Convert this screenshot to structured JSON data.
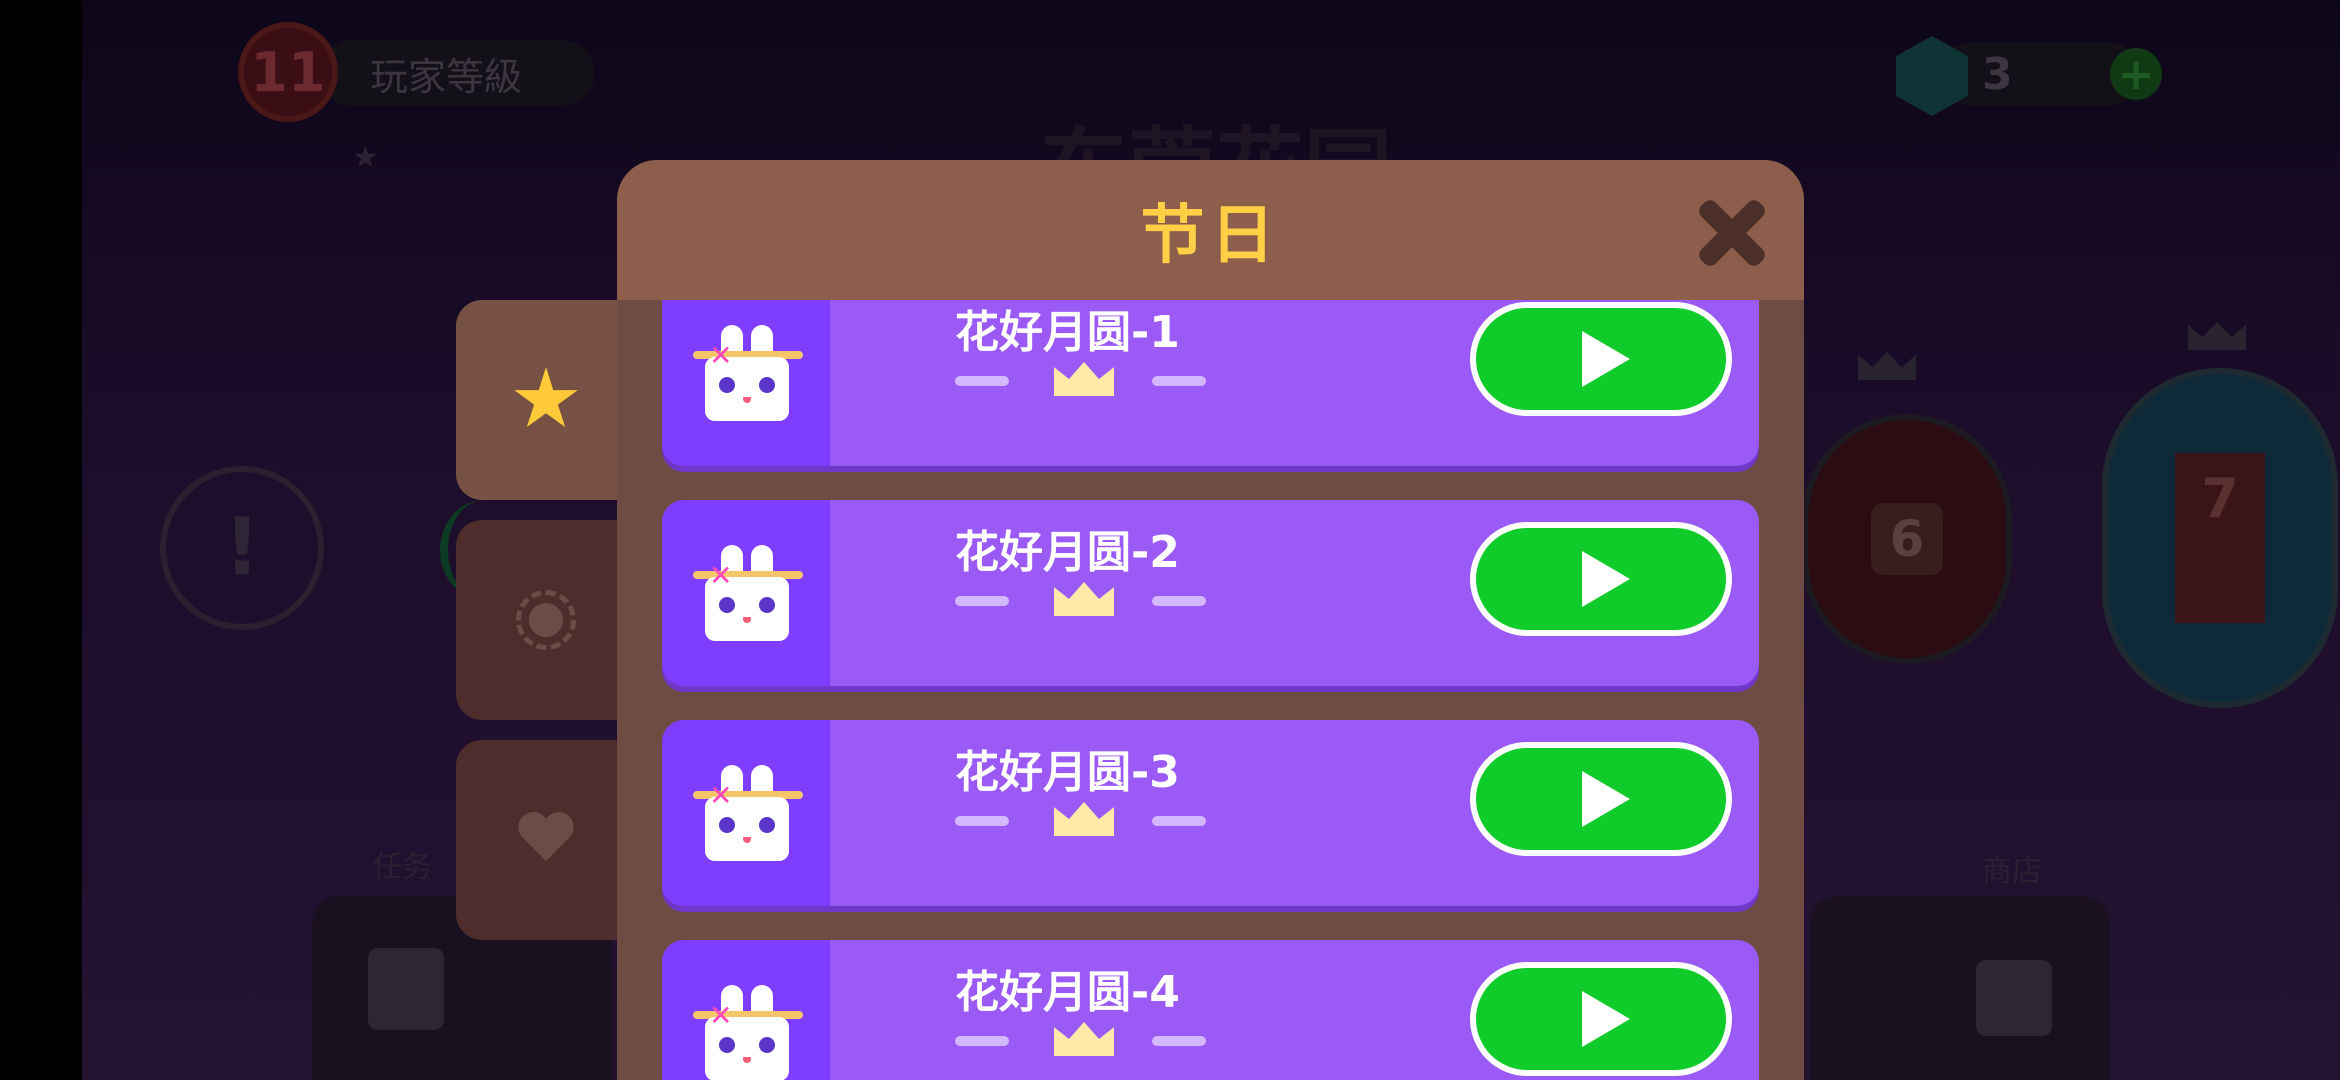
{
  "background": {
    "player_level": "11",
    "player_level_label": "玩家等級",
    "gem_count": "3",
    "page_title": "东莞花园",
    "alert_symbol": "!",
    "level_6": "6",
    "level_7": "7",
    "task_label": "任务",
    "shop_label": "商店"
  },
  "dialog": {
    "title": "节日",
    "close_icon": "close-icon"
  },
  "tabs": [
    {
      "icon": "star-icon",
      "active": true
    },
    {
      "icon": "ring-icon",
      "active": false
    },
    {
      "icon": "heart-icon",
      "active": false
    }
  ],
  "levels": [
    {
      "name": "花好月圆-1",
      "crown": "crown-icon",
      "action": "play-icon"
    },
    {
      "name": "花好月圆-2",
      "crown": "crown-icon",
      "action": "play-icon"
    },
    {
      "name": "花好月圆-3",
      "crown": "crown-icon",
      "action": "play-icon"
    },
    {
      "name": "花好月圆-4",
      "crown": "crown-icon",
      "action": "play-icon"
    }
  ],
  "colors": {
    "dialog_bg": "#6e4c43",
    "header_bg": "#8d5e4b",
    "title_color": "#ffcf45",
    "row_bg": "#9b59f5",
    "thumb_bg": "#7f3dff",
    "play_green": "#10cc2b"
  }
}
